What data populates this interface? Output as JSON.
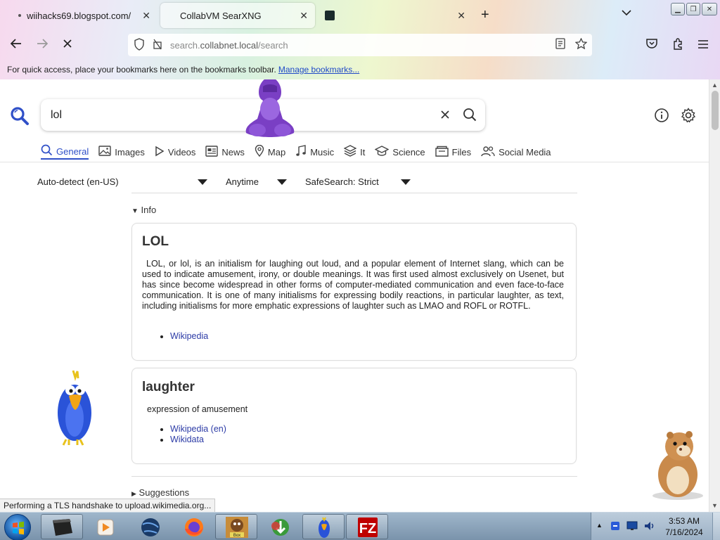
{
  "tabs": [
    {
      "title": "wiihacks69.blogspot.com/",
      "close": "✕"
    },
    {
      "title": "CollabVM SearXNG",
      "close": "✕"
    },
    {
      "title": "",
      "close": "✕"
    }
  ],
  "new_tab": "+",
  "address": {
    "host_prefix": "search.",
    "host": "collabnet.local",
    "path": "/search"
  },
  "bookmarks_hint": {
    "text": "For quick access, place your bookmarks here on the bookmarks toolbar.",
    "link": "Manage bookmarks..."
  },
  "search": {
    "query": "lol"
  },
  "categories": [
    {
      "label": "General",
      "icon": "search-icon",
      "glyph": "🔍",
      "active": true
    },
    {
      "label": "Images",
      "icon": "image-icon",
      "glyph": "🖼"
    },
    {
      "label": "Videos",
      "icon": "play-icon",
      "glyph": "▷"
    },
    {
      "label": "News",
      "icon": "newspaper-icon",
      "glyph": "📰"
    },
    {
      "label": "Map",
      "icon": "map-pin-icon",
      "glyph": "📍"
    },
    {
      "label": "Music",
      "icon": "music-icon",
      "glyph": "♫"
    },
    {
      "label": "It",
      "icon": "layers-icon",
      "glyph": "☰"
    },
    {
      "label": "Science",
      "icon": "graduation-cap-icon",
      "glyph": "🎓"
    },
    {
      "label": "Files",
      "icon": "files-icon",
      "glyph": "🗂"
    },
    {
      "label": "Social Media",
      "icon": "people-icon",
      "glyph": "👥"
    }
  ],
  "filters": {
    "language": "Auto-detect (en-US)",
    "time": "Anytime",
    "safesearch": "SafeSearch: Strict"
  },
  "info": {
    "toggle": "Info",
    "cards": [
      {
        "title": "LOL",
        "body": "LOL, or lol, is an initialism for laughing out loud, and a popular element of Internet slang, which can be used to indicate amusement, irony, or double meanings. It was first used almost exclusively on Usenet, but has since become widespread in other forms of computer-mediated communication and even face-to-face communication. It is one of many initialisms for expressing bodily reactions, in particular laughter, as text, including initialisms for more emphatic expressions of laughter such as LMAO and ROFL or ROTFL.",
        "links": [
          "Wikipedia"
        ]
      },
      {
        "title": "laughter",
        "body": "expression of amusement",
        "links": [
          "Wikipedia (en)",
          "Wikidata"
        ]
      }
    ]
  },
  "suggestions_toggle": "Suggestions",
  "status_text": "Performing a TLS handshake to upload.wikimedia.org...",
  "clock": {
    "time": "3:53 AM",
    "date": "7/16/2024"
  },
  "colors": {
    "accent": "#3050c8",
    "link": "#2c3ba6",
    "bookmark_link": "#1f49c7"
  }
}
